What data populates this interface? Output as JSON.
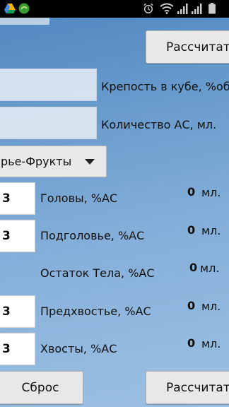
{
  "status_bar": {
    "time": "",
    "icons": [
      "drive-icon",
      "app-icon",
      "alarm-icon",
      "wifi-icon",
      "signal-icon",
      "signal-icon",
      "battery-icon"
    ]
  },
  "top_button": {
    "label": "Рассчитать"
  },
  "fields": {
    "strength_label": "Крепость в кубе, %об.",
    "amount_label": "Количество АС, мл."
  },
  "select": {
    "value": "рье-Фрукты"
  },
  "rows": [
    {
      "input": "3",
      "label": "Головы, %АС",
      "value": "0",
      "unit": "мл."
    },
    {
      "input": "3",
      "label": "Подголовье, %АС",
      "value": "0",
      "unit": "мл."
    },
    {
      "input": "",
      "label": "Остаток Тела, %АС",
      "value": "0",
      "unit": "мл."
    },
    {
      "input": "3",
      "label": "Предхвостье, %АС",
      "value": "0",
      "unit": "мл."
    },
    {
      "input": "3",
      "label": "Хвосты, %АС",
      "value": "0",
      "unit": "мл."
    }
  ],
  "bottom": {
    "reset_label": "Сброс",
    "calc_label": "Рассчитать"
  }
}
